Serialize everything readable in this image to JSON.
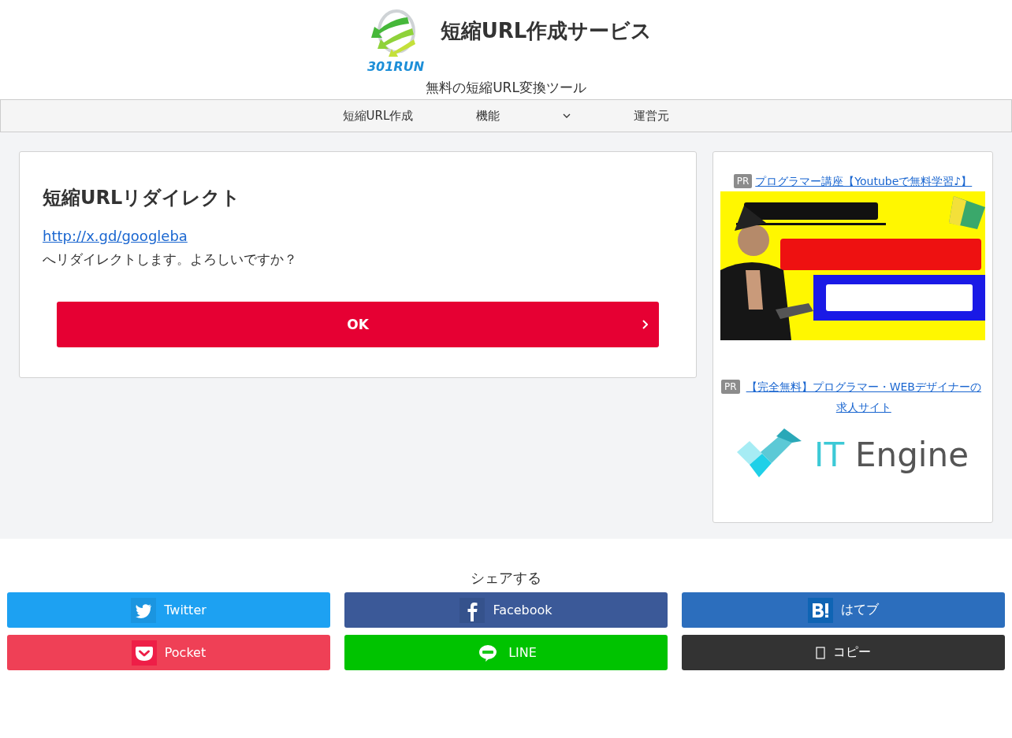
{
  "header": {
    "logo_text": "301RUN",
    "site_title": "短縮URL作成サービス",
    "tagline": "無料の短縮URL変換ツール"
  },
  "nav": [
    {
      "label": "短縮URL作成",
      "dropdown": false
    },
    {
      "label": "機能",
      "dropdown": true
    },
    {
      "label": "運営元",
      "dropdown": false
    }
  ],
  "main": {
    "heading": "短縮URLリダイレクト",
    "link": "http://x.gd/googleba",
    "message": "へリダイレクトします。よろしいですか？",
    "button": "OK"
  },
  "sidebar": {
    "ads": [
      {
        "badge": "PR",
        "link": "プログラマー講座【Youtubeで無料学習♪】",
        "kind": "picture"
      },
      {
        "badge": "PR",
        "link": "【完全無料】プログラマー・WEBデザイナーの求人サイト",
        "kind": "logo",
        "logo_text_1": "IT",
        "logo_text_2": "Engine"
      }
    ]
  },
  "share": {
    "heading": "シェアする",
    "buttons": [
      {
        "label": "Twitter",
        "kind": "twitter",
        "color": "#1da1f2"
      },
      {
        "label": "Facebook",
        "kind": "facebook",
        "color": "#3b5998"
      },
      {
        "label": "はてブ",
        "kind": "hatena",
        "color": "#2c6ebd"
      },
      {
        "label": "Pocket",
        "kind": "pocket",
        "color": "#ef4056"
      },
      {
        "label": "LINE",
        "kind": "line",
        "color": "#00c300"
      },
      {
        "label": "コピー",
        "kind": "copy",
        "color": "#333333"
      }
    ]
  }
}
